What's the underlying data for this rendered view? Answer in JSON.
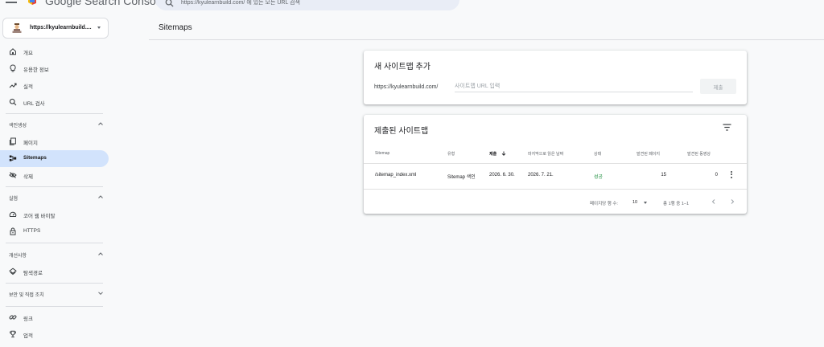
{
  "header": {
    "app_title": "Google Search Console",
    "search_placeholder": "https://kyulearnbuild.com/ 에 있는 모든 URL 검색"
  },
  "property": {
    "label": "https://kyulearnbuild...."
  },
  "sidebar": {
    "top_items": [
      {
        "label": "개요",
        "icon": "home-icon"
      },
      {
        "label": "유용한 정보",
        "icon": "lightbulb-icon"
      },
      {
        "label": "실적",
        "icon": "trending-up-icon"
      },
      {
        "label": "URL 검사",
        "icon": "search-icon"
      }
    ],
    "sections": [
      {
        "label": "색인생성",
        "expanded": true,
        "items": [
          {
            "label": "페이지",
            "icon": "pages-icon"
          },
          {
            "label": "Sitemaps",
            "icon": "sitemaps-icon",
            "active": true
          },
          {
            "label": "삭제",
            "icon": "visibility-off-icon"
          }
        ]
      },
      {
        "label": "실험",
        "expanded": true,
        "items": [
          {
            "label": "코어 웹 바이탈",
            "icon": "speed-icon"
          },
          {
            "label": "HTTPS",
            "icon": "lock-icon"
          }
        ]
      },
      {
        "label": "개선사항",
        "expanded": true,
        "items": [
          {
            "label": "탐색경로",
            "icon": "layers-icon"
          }
        ]
      },
      {
        "label": "보안 및 직접 조치",
        "expanded": false,
        "items": []
      }
    ],
    "bottom_items": [
      {
        "label": "링크",
        "icon": "link-icon"
      },
      {
        "label": "업적",
        "icon": "trophy-icon"
      }
    ]
  },
  "main": {
    "page_title": "Sitemaps",
    "add_card": {
      "title": "새 사이트맵 추가",
      "url_prefix": "https://kyulearnbuild.com/",
      "input_placeholder": "사이트맵 URL 입력",
      "submit_label": "제출"
    },
    "submitted_card": {
      "title": "제출된 사이트맵",
      "columns": [
        "Sitemap",
        "유형",
        "제출",
        "마지막으로 읽은 날짜",
        "상태",
        "발견된 페이지",
        "발견된 동영상"
      ],
      "sorted_column": "제출",
      "sort_direction": "descending",
      "rows": [
        {
          "sitemap": "/sitemap_index.xml",
          "type": "Sitemap 색인",
          "submitted": "2026. 6. 30.",
          "last_read": "2026. 7. 21.",
          "status": "성공",
          "pages": "15",
          "videos": "0"
        }
      ],
      "footer": {
        "rows_per_page_label": "페이지당 행 수:",
        "rows_per_page_value": "10",
        "range_text": "총 1행 중 1–1"
      }
    }
  },
  "colors": {
    "active_nav_bg": "#d2e3fc",
    "success_text": "#1e8e3e",
    "page_bg": "#f8f9fa"
  }
}
